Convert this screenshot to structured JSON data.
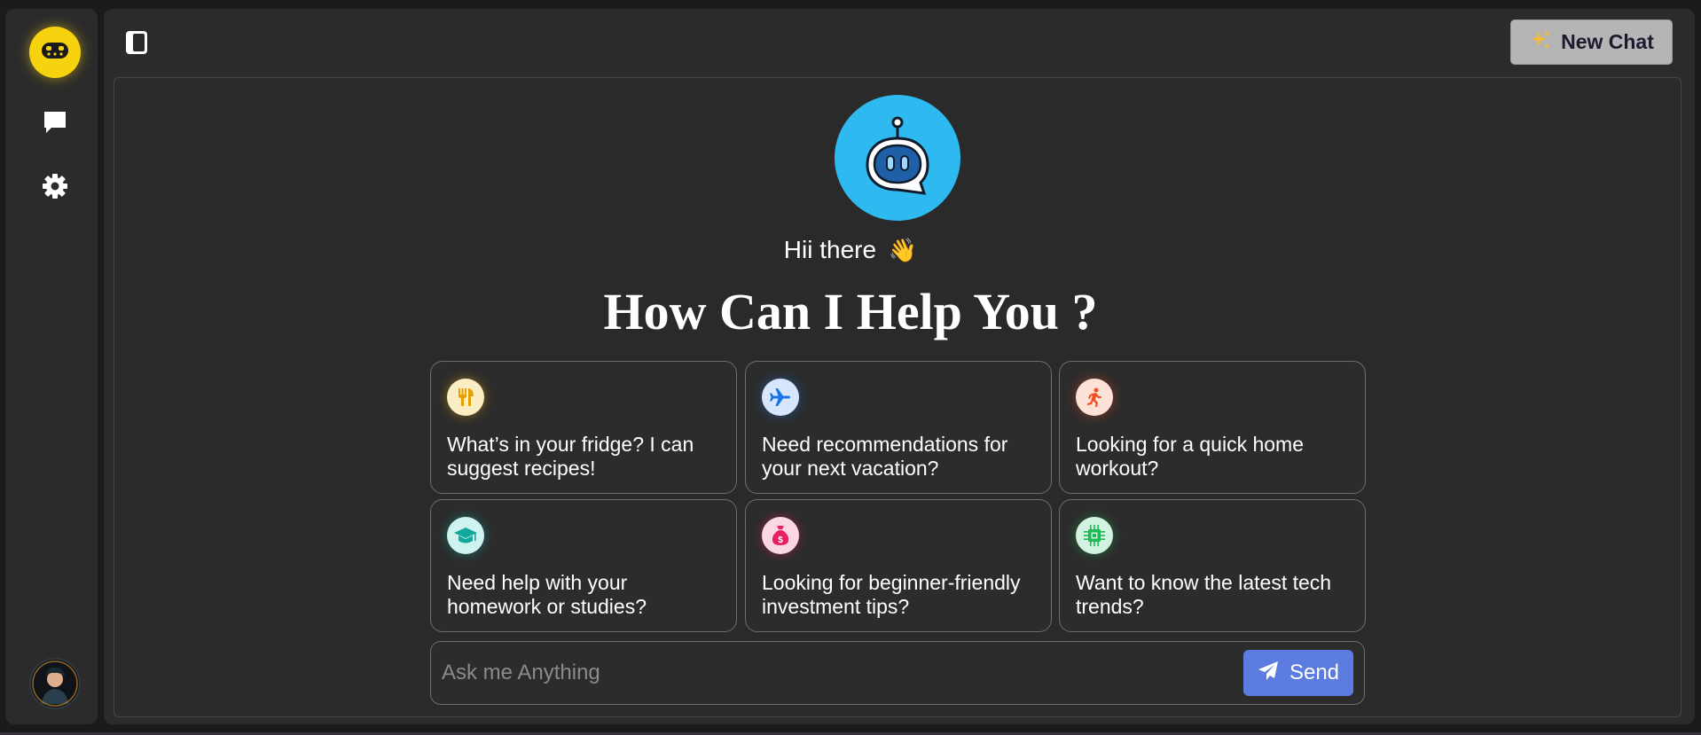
{
  "header": {
    "new_chat_label": "New Chat",
    "new_chat_icon": "sparkles-icon"
  },
  "sidebar": {
    "logo_icon": "chat-bot-icon",
    "items": [
      {
        "name": "chat-icon"
      },
      {
        "name": "gear-icon"
      }
    ],
    "avatar": "user-avatar"
  },
  "main": {
    "greeting": "Hii there",
    "greeting_emoji": "👋",
    "headline": "How Can I Help You ?",
    "suggestions": [
      {
        "text": "What’s in your fridge? I can suggest recipes!",
        "icon": "fork-knife-icon",
        "color": "#f4b400"
      },
      {
        "text": "Need recommendations for your next vacation?",
        "icon": "airplane-icon",
        "color": "#1a73e8"
      },
      {
        "text": "Looking for a quick home workout?",
        "icon": "running-icon",
        "color": "#f25022"
      },
      {
        "text": "Need help with your homework or studies?",
        "icon": "graduation-cap-icon",
        "color": "#12b5a6"
      },
      {
        "text": "Looking for beginner-friendly investment tips?",
        "icon": "money-bag-icon",
        "color": "#e91e63"
      },
      {
        "text": "Want to know the latest tech trends?",
        "icon": "chip-icon",
        "color": "#1db954"
      }
    ]
  },
  "input": {
    "placeholder": "Ask me Anything",
    "send_label": "Send"
  },
  "colors": {
    "accent": "#5c7be0",
    "logo": "#f7d20e",
    "bot": "#2ebaf0"
  }
}
